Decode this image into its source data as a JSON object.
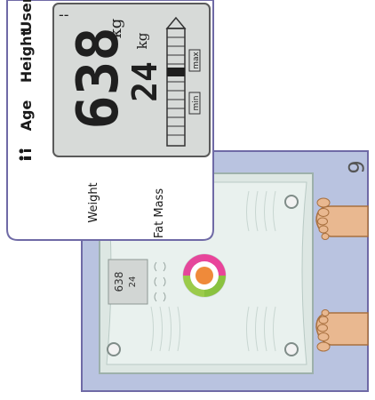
{
  "lcd": {
    "dash": "--",
    "weight_value": "638",
    "weight_unit": "kg",
    "fat_value": "24",
    "fat_unit": "kg",
    "range_min": "min",
    "range_max": "max"
  },
  "header_labels": {
    "user": "User",
    "height": "Height",
    "age": "Age",
    "person_icon": "person-pair-icon"
  },
  "side_labels": {
    "weight": "Weight",
    "fat_mass": "Fat Mass"
  },
  "scale_display": {
    "weight_value": "638",
    "fat_value": "24"
  },
  "step_number": "6",
  "colors": {
    "panel_border": "#6f6aa6",
    "lcd_bg": "#d7dad8",
    "lcd_digits": "#1f1f1f",
    "background_blue": "#b9c3e0",
    "scale_glass": "#dfe8e4",
    "foot": "#e9b890"
  }
}
